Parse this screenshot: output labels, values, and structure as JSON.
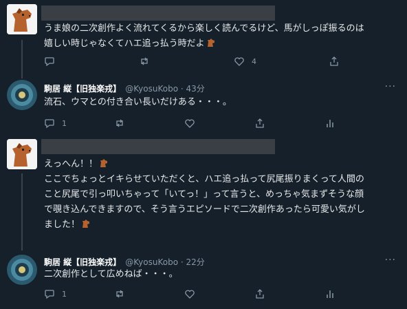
{
  "tweets": [
    {
      "author_name": "",
      "handle": "",
      "time": "",
      "avatar_icon": "horse-avatar-icon",
      "lines": [
        "うま娘の二次創作よく流れてくるから楽しく読んでるけど、馬がしっぽ振るのは",
        "嬉しい時じゃなくてハエ追っ払う時だよ"
      ],
      "emoji_after_last_line": "horse-emoji",
      "reply_count": "",
      "retweet_count": "",
      "like_count": "4"
    },
    {
      "author_name": "駒居 縦【旧独楽戎】",
      "handle": "@KyosuKobo · 43分",
      "time": "43分",
      "avatar_icon": "seal-avatar-icon",
      "lines": [
        "流石、ウマとの付き合い長いだけある・・・。"
      ],
      "reply_count": "1",
      "retweet_count": "",
      "like_count": ""
    },
    {
      "author_name": "",
      "handle": "",
      "time": "",
      "avatar_icon": "horse-avatar-icon",
      "lines": [
        "えっへん！！",
        "ここでちょっとイキらせていただくと、ハエ追っ払って尻尾振りまくって人間の",
        "こと尻尾で引っ叩いちゃって「いてっ！」って言うと、めっちゃ気まずそうな顔",
        "で覗き込んできますので、そう言うエピソードで二次創作あったら可愛い気がし",
        "ました！"
      ],
      "emoji_after_first_line": "horse-emoji",
      "emoji_after_last_line": "horse-emoji",
      "reply_count": "1",
      "retweet_count": "",
      "like_count": ""
    },
    {
      "author_name": "駒居 縦【旧独楽戎】",
      "handle": "@KyosuKobo · 22分",
      "time": "22分",
      "avatar_icon": "seal-avatar-icon",
      "lines": [
        "二次創作として広めねば・・・。"
      ],
      "reply_count": "1",
      "retweet_count": "",
      "like_count": ""
    }
  ],
  "more_icon": "more-icon",
  "colors": {
    "background": "#15202b",
    "text": "#e7e9ea",
    "muted": "#8899a6",
    "redaction": "#3a3f45",
    "horse": "#b5622e"
  }
}
